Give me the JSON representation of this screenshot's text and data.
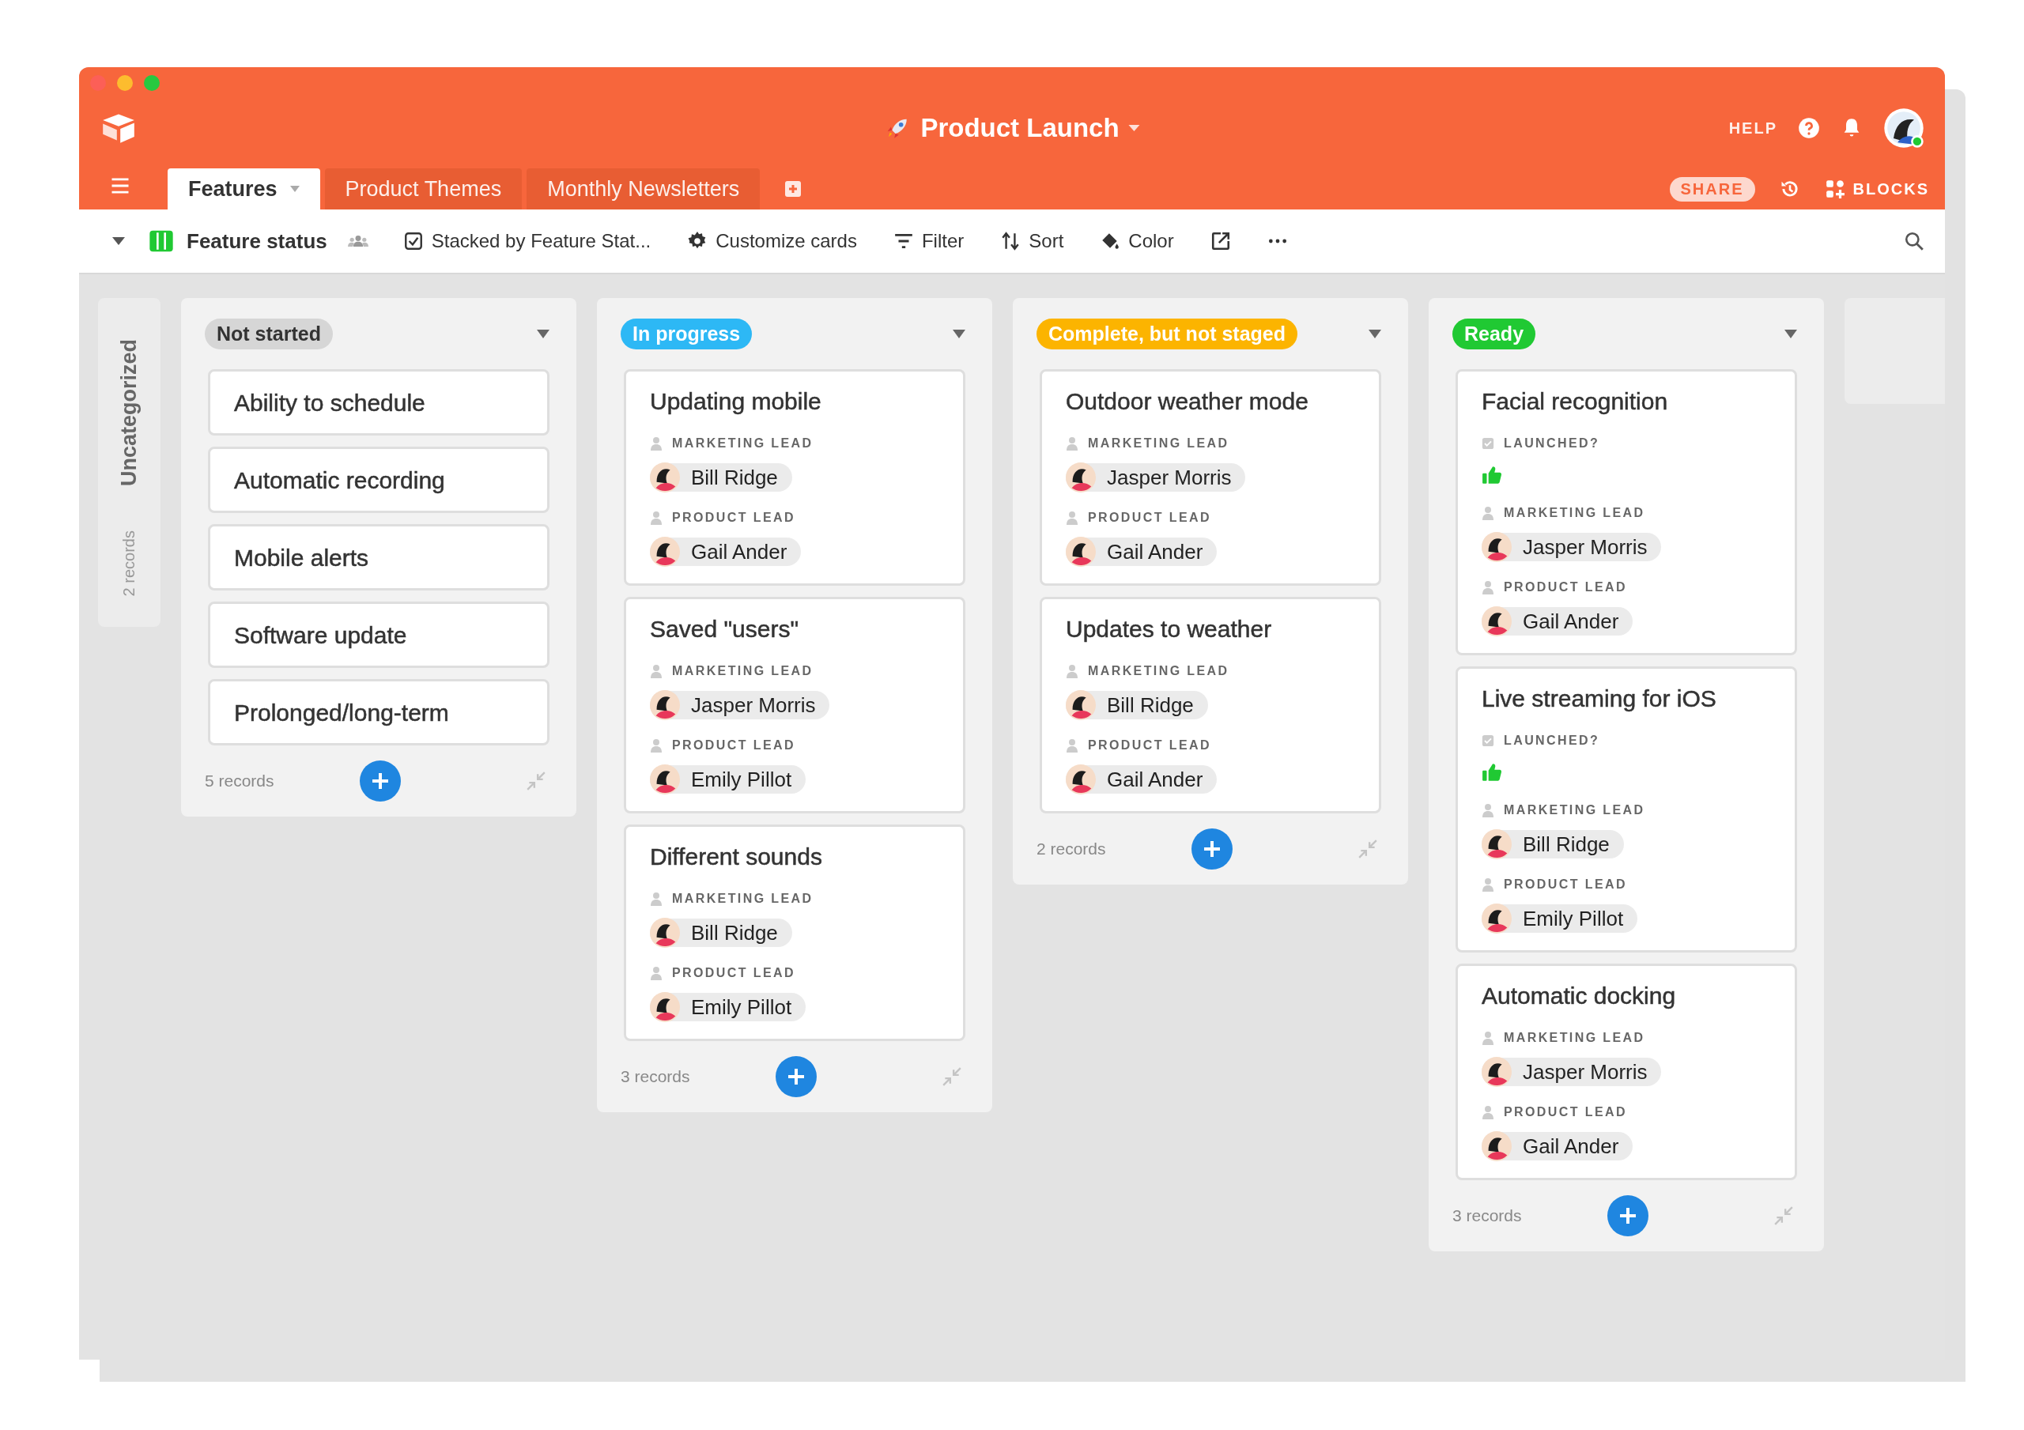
{
  "window": {
    "title": "Product Launch"
  },
  "header": {
    "help": "HELP",
    "share": "SHARE",
    "blocks": "BLOCKS"
  },
  "tabs": [
    {
      "label": "Features",
      "selected": true
    },
    {
      "label": "Product Themes",
      "selected": false
    },
    {
      "label": "Monthly Newsletters",
      "selected": false
    }
  ],
  "toolbar": {
    "view": "Feature status",
    "items": [
      {
        "kind": "stacked",
        "label": "Stacked by Feature Stat..."
      },
      {
        "kind": "customize",
        "label": "Customize cards"
      },
      {
        "kind": "filter",
        "label": "Filter"
      },
      {
        "kind": "sort",
        "label": "Sort"
      },
      {
        "kind": "color",
        "label": "Color"
      },
      {
        "kind": "export"
      },
      {
        "kind": "more"
      }
    ]
  },
  "uncategorized": {
    "label": "Uncategorized",
    "count": "2 records"
  },
  "columns": [
    {
      "status": "Not started",
      "color": "#d6d6d6",
      "records": "5 records",
      "cards": [
        {
          "title": "Ability to schedule"
        },
        {
          "title": "Automatic recording"
        },
        {
          "title": "Mobile alerts"
        },
        {
          "title": "Software update"
        },
        {
          "title": "Prolonged/long-term"
        }
      ]
    },
    {
      "status": "In progress",
      "color": "#2db8f5",
      "records": "3 records",
      "cards": [
        {
          "title": "Updating mobile",
          "fields": [
            {
              "kind": "person",
              "label": "MARKETING LEAD",
              "name": "Bill Ridge"
            },
            {
              "kind": "person",
              "label": "PRODUCT LEAD",
              "name": "Gail Ander"
            }
          ]
        },
        {
          "title": "Saved \"users\"",
          "fields": [
            {
              "kind": "person",
              "label": "MARKETING LEAD",
              "name": "Jasper Morris"
            },
            {
              "kind": "person",
              "label": "PRODUCT LEAD",
              "name": "Emily Pillot"
            }
          ]
        },
        {
          "title": "Different sounds",
          "fields": [
            {
              "kind": "person",
              "label": "MARKETING LEAD",
              "name": "Bill Ridge"
            },
            {
              "kind": "person",
              "label": "PRODUCT LEAD",
              "name": "Emily Pillot"
            }
          ]
        }
      ]
    },
    {
      "status": "Complete, but not staged",
      "color": "#fcb400",
      "records": "2 records",
      "cards": [
        {
          "title": "Outdoor weather mode",
          "fields": [
            {
              "kind": "person",
              "label": "MARKETING LEAD",
              "name": "Jasper Morris"
            },
            {
              "kind": "person",
              "label": "PRODUCT LEAD",
              "name": "Gail Ander"
            }
          ]
        },
        {
          "title": "Updates to weather",
          "fields": [
            {
              "kind": "person",
              "label": "MARKETING LEAD",
              "name": "Bill Ridge"
            },
            {
              "kind": "person",
              "label": "PRODUCT LEAD",
              "name": "Gail Ander"
            }
          ]
        }
      ]
    },
    {
      "status": "Ready",
      "color": "#20c933",
      "records": "3 records",
      "cards": [
        {
          "title": "Facial recognition",
          "fields": [
            {
              "kind": "checkbox",
              "label": "LAUNCHED?",
              "checked": true
            },
            {
              "kind": "person",
              "label": "MARKETING LEAD",
              "name": "Jasper Morris"
            },
            {
              "kind": "person",
              "label": "PRODUCT LEAD",
              "name": "Gail Ander"
            }
          ]
        },
        {
          "title": "Live streaming for iOS",
          "fields": [
            {
              "kind": "checkbox",
              "label": "LAUNCHED?",
              "checked": true
            },
            {
              "kind": "person",
              "label": "MARKETING LEAD",
              "name": "Bill Ridge"
            },
            {
              "kind": "person",
              "label": "PRODUCT LEAD",
              "name": "Emily Pillot"
            }
          ]
        },
        {
          "title": "Automatic docking",
          "fields": [
            {
              "kind": "person",
              "label": "MARKETING LEAD",
              "name": "Jasper Morris"
            },
            {
              "kind": "person",
              "label": "PRODUCT LEAD",
              "name": "Gail Ander"
            }
          ]
        }
      ]
    }
  ]
}
